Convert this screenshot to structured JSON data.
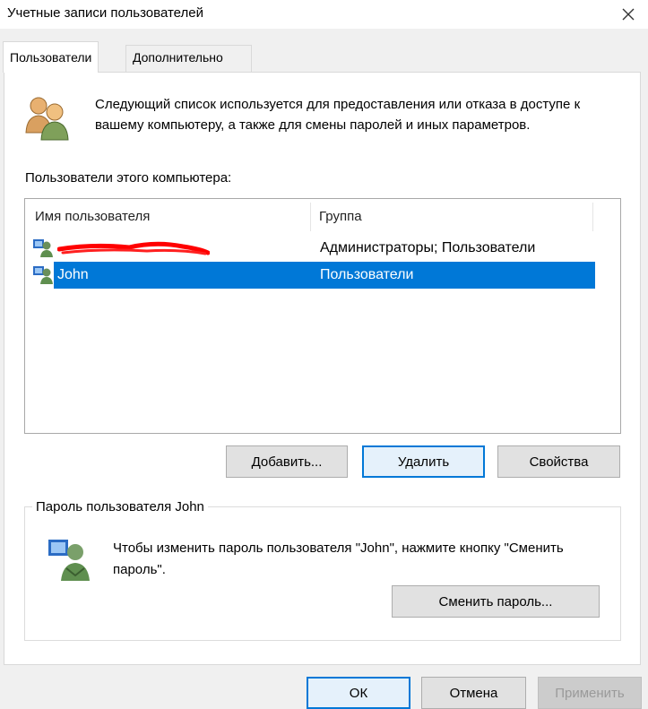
{
  "window": {
    "title": "Учетные записи пользователей"
  },
  "tabs": [
    {
      "label": "Пользователи",
      "active": true
    },
    {
      "label": "Дополнительно",
      "active": false
    }
  ],
  "intro": {
    "text": "Следующий список используется для предоставления или отказа в доступе к вашему компьютеру, а также для смены паролей и иных параметров."
  },
  "users": {
    "label": "Пользователи этого компьютера:",
    "columns": [
      "Имя пользователя",
      "Группа"
    ],
    "rows": [
      {
        "name": "",
        "group": "Администраторы; Пользователи",
        "redacted": true,
        "selected": false
      },
      {
        "name": "John",
        "group": "Пользователи",
        "redacted": false,
        "selected": true
      }
    ],
    "buttons": {
      "add": "Добавить...",
      "remove": "Удалить",
      "properties": "Свойства"
    }
  },
  "password": {
    "group_label": "Пароль пользователя John",
    "text": "Чтобы изменить пароль пользователя \"John\", нажмите кнопку \"Сменить пароль\".",
    "change_button": "Сменить пароль..."
  },
  "footer": {
    "ok": "ОК",
    "cancel": "Отмена",
    "apply": "Применить"
  },
  "colors": {
    "selection": "#0078d7",
    "redaction": "#ff0000"
  },
  "icons": {
    "header": "users-group-icon",
    "row": "user-account-icon",
    "password": "user-key-icon",
    "close": "close-icon"
  }
}
